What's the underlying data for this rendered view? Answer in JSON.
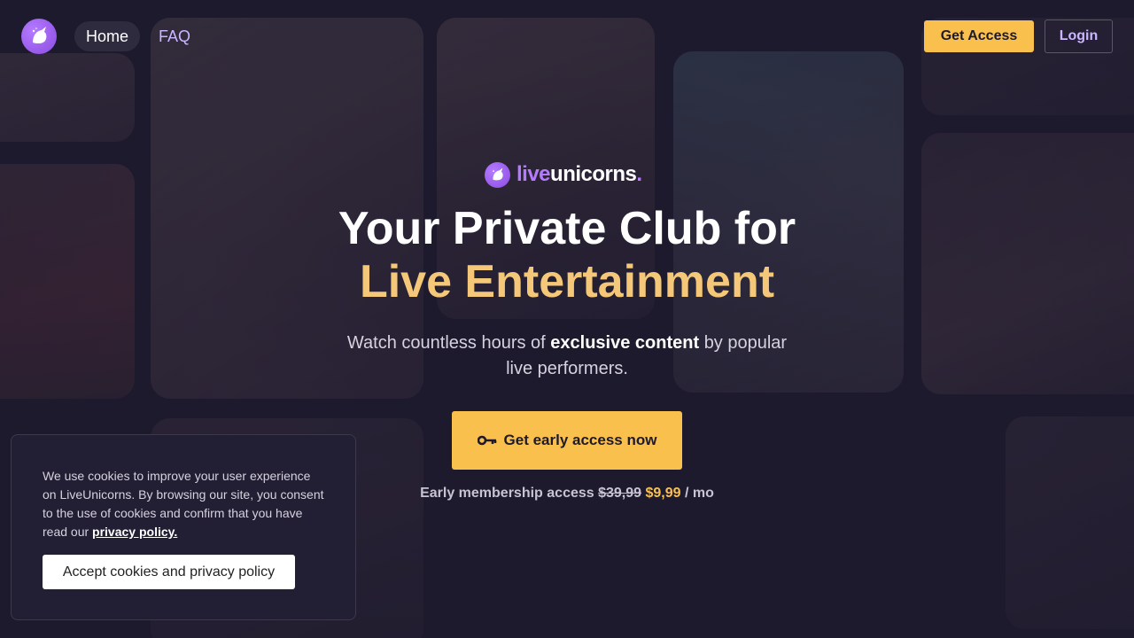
{
  "nav": {
    "items": [
      {
        "label": "Home",
        "active": true
      },
      {
        "label": "FAQ",
        "active": false
      }
    ],
    "get_access": "Get Access",
    "login": "Login"
  },
  "brand": {
    "part1": "live",
    "part2": "unicorns",
    "dot": "."
  },
  "hero": {
    "headline_line1": "Your Private Club for",
    "headline_line2": "Live Entertainment",
    "subtitle_before": "Watch countless hours of",
    "subtitle_bold": "exclusive content",
    "subtitle_after": "by popular live performers.",
    "cta_label": "Get early access now",
    "pricing_label": "Early membership access",
    "old_price": "$39,99",
    "new_price": "$9,99",
    "period": "/ mo"
  },
  "cookie": {
    "text": "We use cookies to improve your user experience on LiveUnicorns. By browsing our site, you consent to the use of cookies and confirm that you have read our",
    "link": "privacy policy.",
    "button": "Accept cookies and privacy policy"
  },
  "colors": {
    "background": "#1e1a2e",
    "accent": "#f9c04d",
    "brand_purple": "#b57bff",
    "headline_gold": "#f4c878"
  },
  "icons": [
    "unicorn-logo-icon",
    "key-icon"
  ]
}
